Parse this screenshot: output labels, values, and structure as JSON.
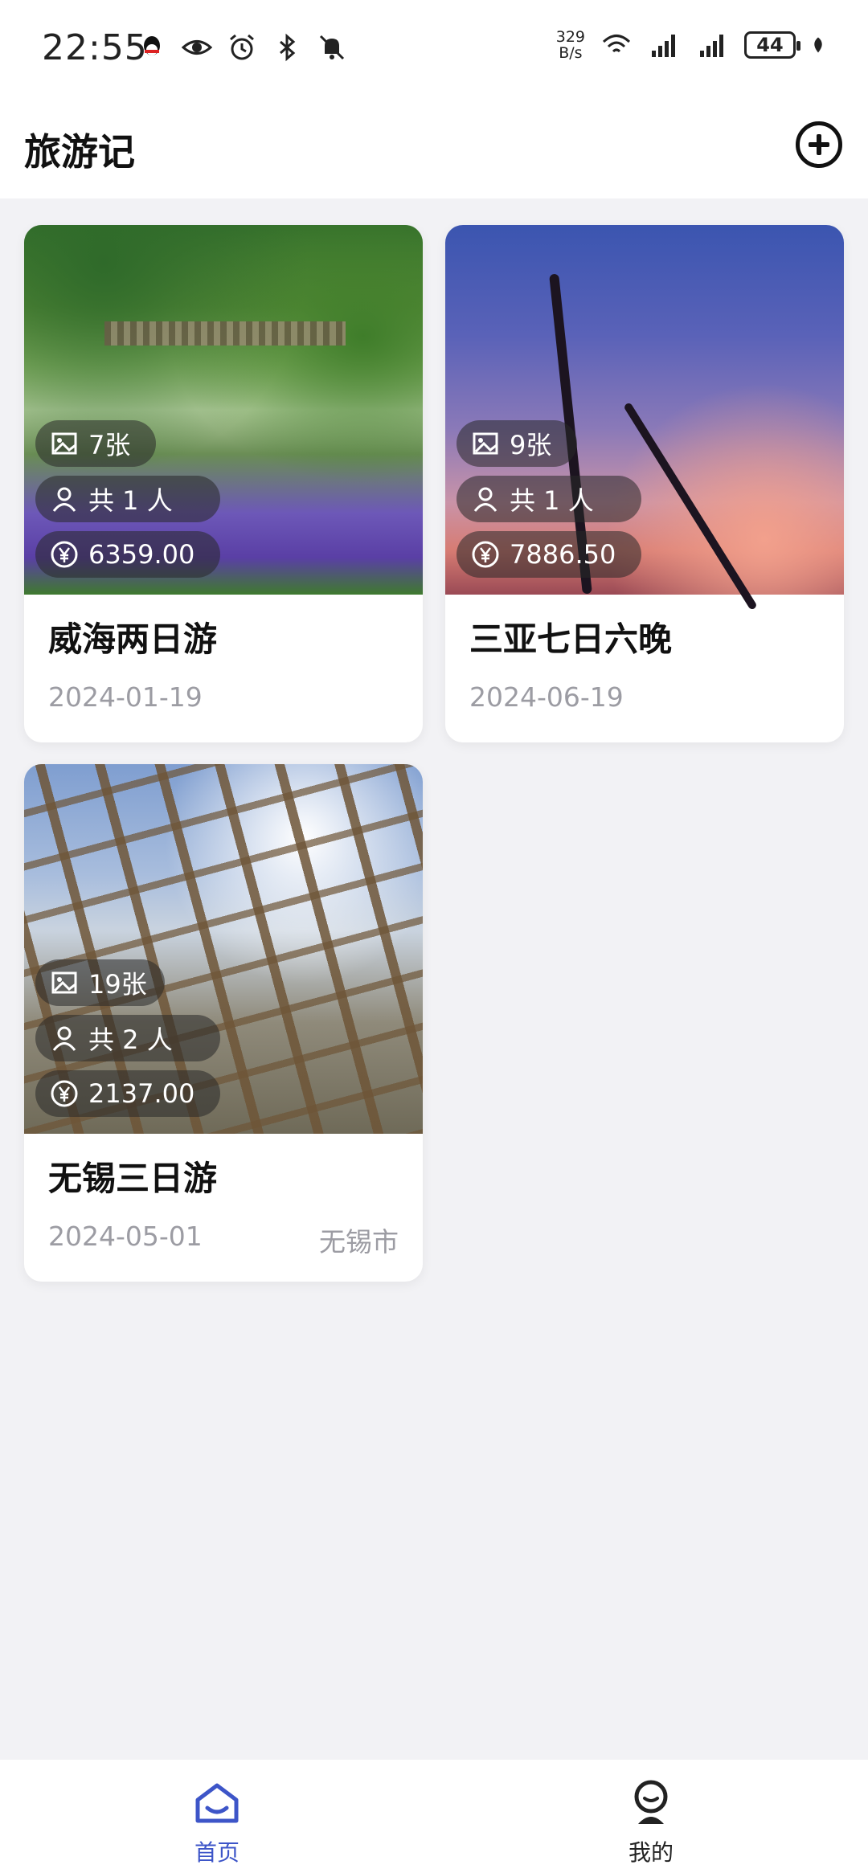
{
  "status_bar": {
    "time": "22:55",
    "net_speed_value": "329",
    "net_speed_unit": "B/s",
    "battery": "44",
    "icons": [
      "qq-icon",
      "eye-icon",
      "alarm-icon",
      "bluetooth-icon",
      "mute-icon",
      "wifi-icon",
      "signal-icon",
      "signal-icon",
      "battery-icon",
      "leaf-icon"
    ]
  },
  "header": {
    "title": "旅游记",
    "add_icon": "plus-circle-icon"
  },
  "trips": [
    {
      "title": "威海两日游",
      "date": "2024-01-19",
      "city": "",
      "photos": "7张",
      "people": "共 1 人",
      "cost": "6359.00"
    },
    {
      "title": "三亚七日六晚",
      "date": "2024-06-19",
      "city": "",
      "photos": "9张",
      "people": "共 1 人",
      "cost": "7886.50"
    },
    {
      "title": "无锡三日游",
      "date": "2024-05-01",
      "city": "无锡市",
      "photos": "19张",
      "people": "共 2 人",
      "cost": "2137.00"
    }
  ],
  "bottom_nav": {
    "items": [
      {
        "label": "首页",
        "icon": "home-icon",
        "active": true
      },
      {
        "label": "我的",
        "icon": "profile-icon",
        "active": false
      }
    ],
    "active_color": "#3d55c8"
  }
}
